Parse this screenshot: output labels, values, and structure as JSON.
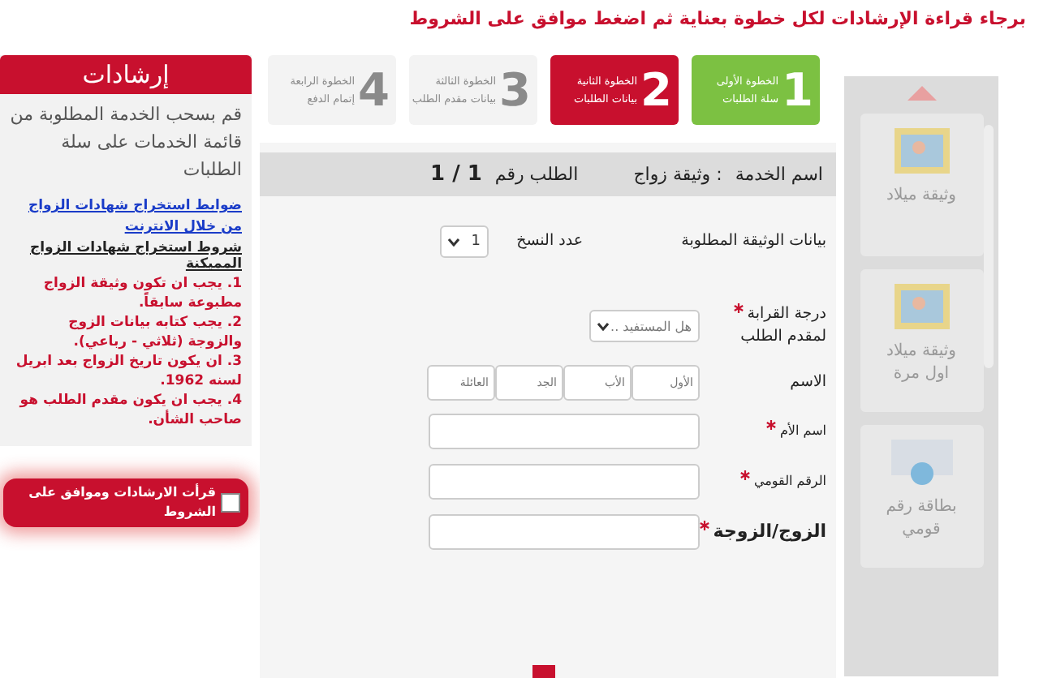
{
  "instruction": "برجاء قراءة الإرشادات لكل خطوة بعناية ثم اضغط موافق على الشروط",
  "guide": {
    "title": "إرشادات",
    "intro": "قم بسحب الخدمة المطلوبة من قائمة الخدمات على سلة الطلبات",
    "link": "ضوابط استخراج شهادات الزواج من خلال الانترنت",
    "conditions_title": "شروط استخراج شهادات الزواج المميكنة",
    "conditions": [
      "1. يجب ان تكون وثيقة الزواج مطبوعة سابقاً.",
      "2. يجب كتابه بيانات الزوج والزوجة (ثلاثي - رباعي).",
      "3. ان يكون تاريخ الزواج بعد ابريل لسنه 1962.",
      "4. يجب ان يكون مقدم الطلب هو صاحب الشأن."
    ],
    "agree": {
      "label": "قرأت الارشادات وموافق على الشروط",
      "checked": false
    }
  },
  "steps": [
    {
      "number": "1",
      "title": "الخطوة الأولى",
      "subtitle": "سلة الطلبات",
      "completed": true,
      "selected": false
    },
    {
      "number": "2",
      "title": "الخطوة الثانية",
      "subtitle": "بيانات الطلبات",
      "completed": false,
      "selected": true
    },
    {
      "number": "3",
      "title": "الخطوة الثالثة",
      "subtitle": "بيانات مقدم الطلب",
      "completed": false,
      "selected": false
    },
    {
      "number": "4",
      "title": "الخطوة الرابعة",
      "subtitle": "إتمام الدفع",
      "completed": false,
      "selected": false
    }
  ],
  "form": {
    "service_label": "اسم الخدمة",
    "service_value": ": وثيقة زواج",
    "request_label": "الطلب رقم",
    "request_value": "1 / 1",
    "section_title": "بيانات الوثيقة المطلوبة",
    "copies_label": "عدد النسخ",
    "copies_value": "1",
    "relation": {
      "label": "درجة القرابة",
      "sublabel": "لمقدم الطلب",
      "required": true,
      "placeholder": "هل المستفيد .."
    },
    "name": {
      "label": "الاسم",
      "parts": [
        {
          "placeholder": "الأول"
        },
        {
          "placeholder": "الأب"
        },
        {
          "placeholder": "الجد"
        },
        {
          "placeholder": "العائلة"
        }
      ]
    },
    "fields": [
      {
        "label": "اسم الأم",
        "required": true,
        "kind": "small"
      },
      {
        "label": "الرقم القومي",
        "required": true,
        "kind": "small"
      },
      {
        "label": "الزوج/الزوجة",
        "required": true,
        "kind": "large"
      }
    ]
  },
  "services": [
    {
      "label": "وثيقة ميلاد",
      "kind": "frame"
    },
    {
      "label": "وثيقة ميلاد اول مرة",
      "kind": "frame"
    },
    {
      "label": "بطاقة رقم قومي",
      "kind": "card"
    }
  ]
}
